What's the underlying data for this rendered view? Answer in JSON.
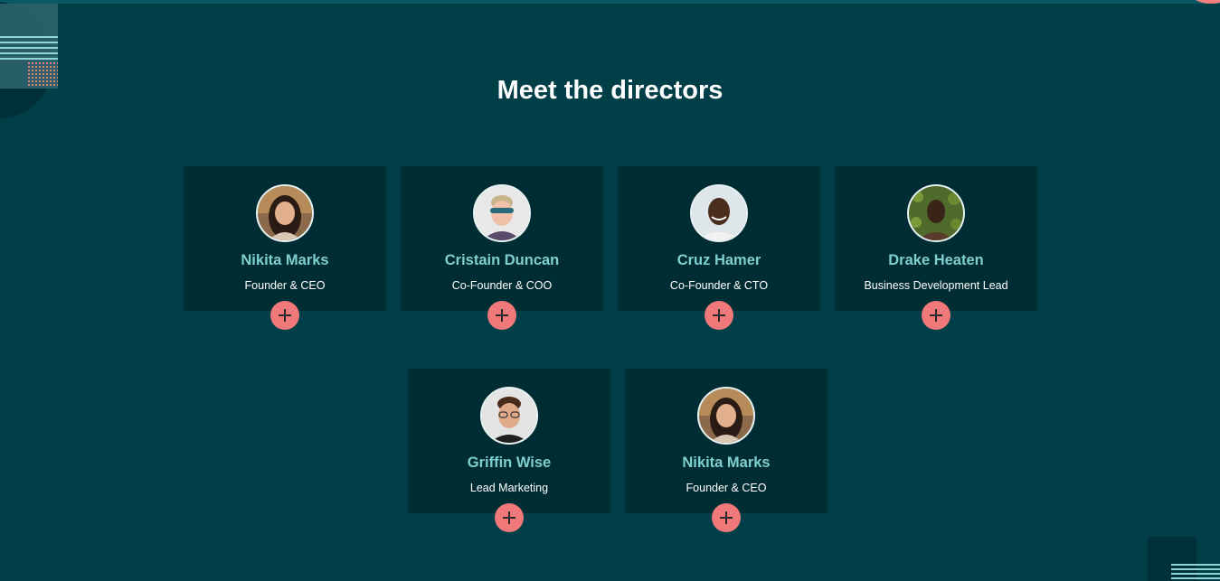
{
  "section": {
    "title": "Meet the directors"
  },
  "directors": [
    {
      "name": "Nikita Marks",
      "role": "Founder & CEO"
    },
    {
      "name": "Cristain Duncan",
      "role": "Co-Founder & COO"
    },
    {
      "name": "Cruz Hamer",
      "role": "Co-Founder & CTO"
    },
    {
      "name": "Drake Heaten",
      "role": "Business Development Lead"
    },
    {
      "name": "Griffin Wise",
      "role": "Lead Marketing"
    },
    {
      "name": "Nikita Marks",
      "role": "Founder & CEO"
    }
  ],
  "icons": {
    "expand_button": "plus-icon"
  },
  "colors": {
    "background": "#003f48",
    "card": "#002c33",
    "name_text": "#7fcfcf",
    "accent": "#f07878"
  }
}
